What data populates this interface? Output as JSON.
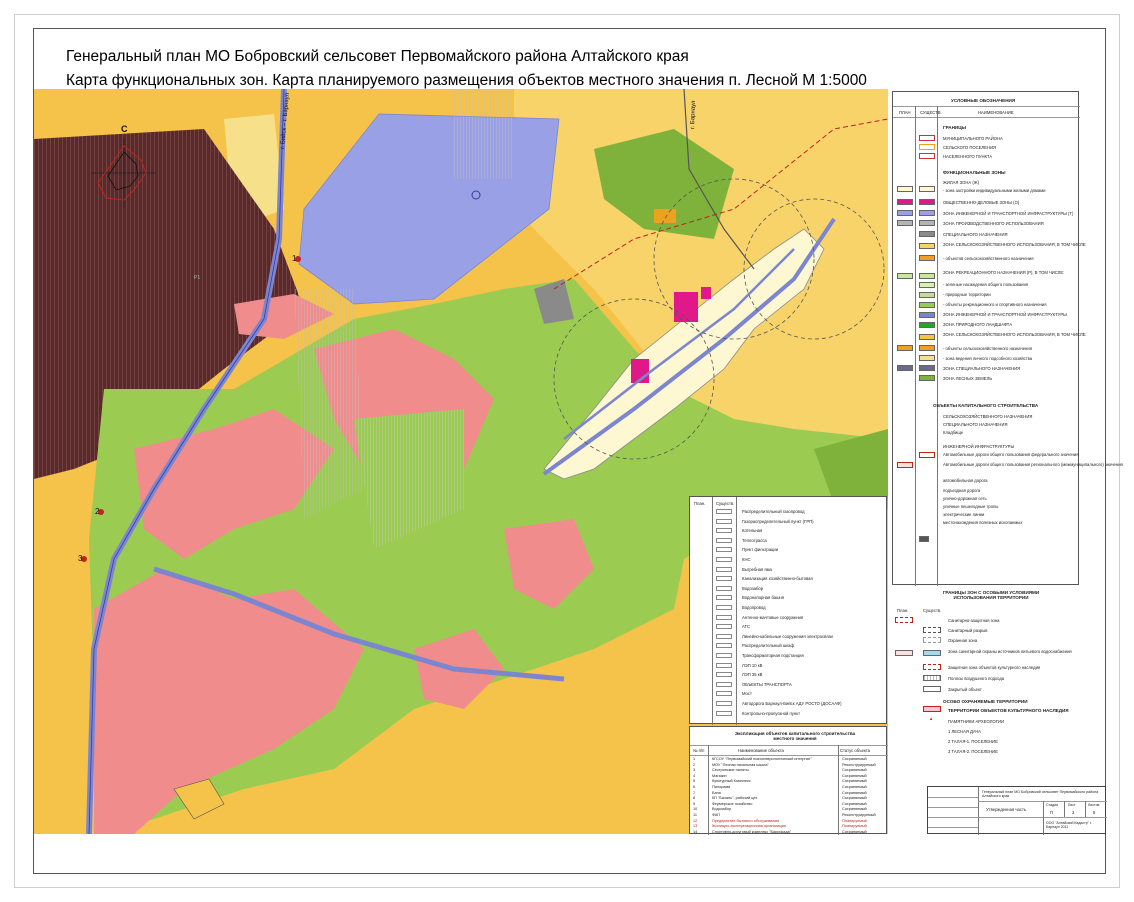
{
  "title": {
    "line1": "Генеральный план МО Бобровский сельсовет Первомайского района Алтайского края",
    "line2": "Карта функциональных зон. Карта планируемого размещения объектов местного значения п. Лесной  М 1:5000"
  },
  "compass": {
    "north_label": "С"
  },
  "colors": {
    "residential": "#fdf7d2",
    "agricultural": "#f5c24a",
    "recreation": "#9ccb52",
    "forest": "#7fb23a",
    "industrial": "#9aa0e6",
    "public": "#e0198a",
    "protected": "#f08c8c",
    "special": "#5a2a2a",
    "roads": "#7c86d0",
    "boundary": "#c8323c"
  },
  "legend_main": {
    "header": "УСЛОВНЫЕ ОБОЗНАЧЕНИЯ",
    "col_headers": [
      "ПЛАН",
      "СУЩЕСТВ.",
      "НАИМЕНОВАНИЕ"
    ],
    "section_boundaries": "ГРАНИЦЫ",
    "boundaries": [
      "МУНИЦИПАЛЬНОГО РАЙОНА",
      "СЕЛЬСКОГО ПОСЕЛЕНИЯ",
      "НАСЕЛЕННОГО ПУНКТА"
    ],
    "section_zones": "ФУНКЦИОНАЛЬНЫЕ ЗОНЫ",
    "zones": [
      "ЖИЛАЯ ЗОНА (Ж)",
      "- зона застройки индивидуальными жилыми домами",
      "ОБЩЕСТВЕННО-ДЕЛОВЫЕ ЗОНЫ (О)",
      "ЗОНА ИНЖЕНЕРНОЙ И ТРАНСПОРТНОЙ ИНФРАСТРУКТУРЫ (Т)",
      "ЗОНА ПРОИЗВОДСТВЕННОГО ИСПОЛЬЗОВАНИЯ",
      "СПЕЦИАЛЬНОГО НАЗНАЧЕНИЯ",
      "ЗОНА СЕЛЬСКОХОЗЯЙСТВЕННОГО ИСПОЛЬЗОВАНИЯ, В ТОМ ЧИСЛЕ:",
      "- объектов сельскохозяйственного назначения",
      "ЗОНА РЕКРЕАЦИОННОГО НАЗНАЧЕНИЯ (Р), В ТОМ ЧИСЛЕ:",
      "- зеленые насаждения общего пользования",
      "- природные территории",
      "- объекты рекреационного и спортивного назначения",
      "ЗОНА ИНЖЕНЕРНОЙ И ТРАНСПОРТНОЙ ИНФРАСТРУКТУРЫ",
      "ЗОНА ПРИРОДНОГО ЛАНДШАФТА",
      "ЗОНА СЕЛЬСКОХОЗЯЙСТВЕННОГО ИСПОЛЬЗОВАНИЯ, В ТОМ ЧИСЛЕ:",
      "- объекты сельскохозяйственного назначения",
      "- зона ведения личного подсобного хозяйства",
      "ЗОНА СПЕЦИАЛЬНОГО НАЗНАЧЕНИЯ",
      "ЗОНА ЛЕСНЫХ ЗЕМЕЛЬ"
    ],
    "section_objects": "ОБЪЕКТЫ КАПИТАЛЬНОГО СТРОИТЕЛЬСТВА",
    "objects": [
      "СЕЛЬСКОХОЗЯЙСТВЕННОГО НАЗНАЧЕНИЯ",
      "СПЕЦИАЛЬНОГО НАЗНАЧЕНИЯ",
      "Кладбище",
      "ИНЖЕНЕРНОЙ ИНФРАСТРУКТУРЫ",
      "Автомобильные дороги общего пользования федерального значения",
      "Автомобильные дороги общего пользования регионального (межмуниципального) значения",
      "автомобильная дорога",
      "подъездная дорога",
      "улично-дорожная сеть",
      "уличные пешеходные тропы",
      "электрические линии",
      "местонахождения полезных ископаемых"
    ]
  },
  "legend_engineering": {
    "col_headers": [
      "План.",
      "Существ."
    ],
    "items": [
      "Распределительный газопровод",
      "Газораспределительный пункт (ГРП)",
      "Котельная",
      "Теплотрасса",
      "Пункт фильтрации",
      "КНС",
      "Выгребная яма",
      "Канализация хозяйственно-бытовая",
      "Водозабор",
      "Водонапорная башня",
      "Водопровод",
      "Антенно-мачтовые сооружения",
      "АТС",
      "Линейно-кабельные сооружения электросвязи",
      "Распределительный шкаф",
      "Трансформаторная подстанция",
      "ЛЭП 10 кВ",
      "ЛЭП 35 кВ",
      "ОБЪЕКТЫ ТРАНСПОРТА",
      "Мост",
      "Автодорога Барнаул-Бийск АДУ РОСТО (ДОСААФ)",
      "Контрольно-пропускной пункт"
    ]
  },
  "legend_restrictions": {
    "header": "ГРАНИЦЫ ЗОН С ОСОБЫМИ УСЛОВИЯМИ ИСПОЛЬЗОВАНИЯ ТЕРРИТОРИИ",
    "col_headers": [
      "План.",
      "Существ."
    ],
    "items": [
      "Санитарно-защитная зона",
      "Санитарный разрыв",
      "Охранная зона",
      "Зона санитарной охраны источников питьевого водоснабжения",
      "Защитная зона объектов культурного наследия",
      "Полосы воздушного подхода",
      "Закрытый объект"
    ],
    "section_protected": "ОСОБО ОХРАНЯЕМЫЕ ТЕРРИТОРИИ",
    "protected_item": "ТЕРРИТОРИИ ОБЪЕКТОВ КУЛЬТУРНОГО НАСЛЕДИЯ",
    "monuments_header": "ПАМЯТНИКИ АРХЕОЛОГИИ",
    "monuments": [
      "1 ЛЕСНАЯ ДАЧА",
      "2 ТАЛАЯ-1. ПОСЕЛЕНИЕ",
      "3 ТАЛАЯ-2. ПОСЕЛЕНИЕ"
    ]
  },
  "explication": {
    "title": "Экспликация объектов капитального строительства местного значения",
    "columns": [
      "№ п/п",
      "Наименование объекта",
      "Статус объекта"
    ],
    "rows": [
      [
        "1",
        "КГСОУ \"Первомайский психоневрологический интернат\"",
        "Сохраняемый"
      ],
      [
        "2",
        "МОУ \"Лесная начальная школа\"",
        "Реконструируемый"
      ],
      [
        "3",
        "Сестринские палаты",
        "Сохраняемый"
      ],
      [
        "4",
        "Магазин",
        "Сохраняемый"
      ],
      [
        "5",
        "Культурный Комплекс",
        "Сохраняемый"
      ],
      [
        "6",
        "Пилорама",
        "Сохраняемый"
      ],
      [
        "7",
        "Баня",
        "Сохраняемый"
      ],
      [
        "8",
        "КП \"Бачаль\", рабочий цех",
        "Сохраняемый"
      ],
      [
        "9",
        "Фермерское хозяйство",
        "Сохраняемый"
      ],
      [
        "10",
        "Водозабор",
        "Сохраняемый"
      ],
      [
        "11",
        "ФАП",
        "Реконструируемый"
      ],
      [
        "12",
        "Предприятие бытового обслуживания",
        "Планируемый"
      ],
      [
        "13",
        "Жилищно-эксплуатационная организация",
        "Планируемый"
      ],
      [
        "14",
        "Спортивно-досуговый комплекс \"Баррикада\"",
        "Сохраняемый"
      ]
    ]
  },
  "stamp": {
    "project_text": "Генеральный план МО Бобровский сельсовет Первомайского района Алтайского края",
    "sheet_title": "Утвержденная часть",
    "labels": [
      "Стадия",
      "Лист",
      "Листов"
    ],
    "values": [
      "П",
      "3",
      "5"
    ],
    "org": "ООО \"Алтайский Кадастр\" г. Барнаул 2011"
  },
  "map_labels": {
    "road_north": "г. Барнаул",
    "road_left": "г. Бийск – г. Барнаул",
    "zone_codes": [
      "Р1",
      "Ж1",
      "С"
    ],
    "monument_numbers": [
      "1",
      "2",
      "3"
    ]
  }
}
